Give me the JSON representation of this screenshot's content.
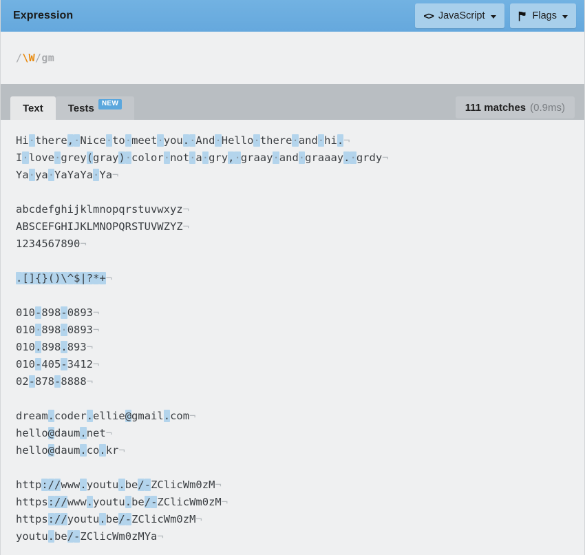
{
  "header": {
    "title": "Expression",
    "buttons": [
      {
        "name": "flavor-button",
        "icon": "code-icon",
        "label": "JavaScript"
      },
      {
        "name": "flags-button",
        "icon": "flag-icon",
        "label": "Flags"
      }
    ]
  },
  "expression": {
    "open_delimiter": "/",
    "pattern": "\\W",
    "close_delimiter": "/",
    "flags": "gm",
    "full": "/\\W/gm"
  },
  "tabs": [
    {
      "label": "Text",
      "active": true,
      "badge": null
    },
    {
      "label": "Tests",
      "active": false,
      "badge": "NEW"
    }
  ],
  "matches": {
    "count_label": "111 matches",
    "time_label": "(0.9ms)"
  },
  "test_string": {
    "lines": [
      "Hi there, Nice to meet you. And Hello there and hi.",
      "I love grey(gray) color not a gry, graay and graaay. grdy",
      "Ya ya YaYaYa Ya",
      "",
      "abcdefghijklmnopqrstuvwxyz",
      "ABSCEFGHIJKLMNOPQRSTUVWZYZ",
      "1234567890",
      "",
      ".[]{}()\\^$|?*+",
      "",
      "010-898-0893",
      "010 898 0893",
      "010.898.893",
      "010-405-3412",
      "02-878-8888",
      "",
      "dream.coder.ellie@gmail.com",
      "hello@daum.net",
      "hello@daum.co.kr",
      "",
      "http://www.youtu.be/-ZClicWm0zM",
      "https://www.youtu.be/-ZClicWm0zM",
      "https://youtu.be/-ZClicWm0zM",
      "youtu.be/-ZClicWm0zMYa"
    ],
    "newline_glyph": "¬",
    "space_glyph": "·"
  },
  "colors": {
    "header_blue": "#6bade0",
    "button_blue": "#a8cfeb",
    "highlight_blue": "#b3d4ec",
    "badge_blue": "#5ba7dd",
    "tabbar_gray": "#b9bec2",
    "panel_gray": "#eff0f1",
    "token_orange": "#e8890c"
  }
}
